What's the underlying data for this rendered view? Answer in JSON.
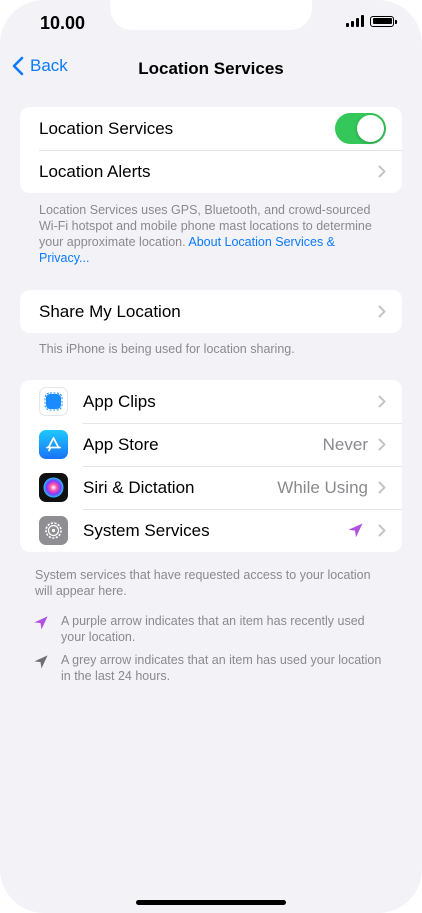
{
  "status_bar": {
    "time": "10.00"
  },
  "nav": {
    "back_label": "Back",
    "title": "Location Services"
  },
  "group1": {
    "location_services_label": "Location Services",
    "location_services_on": true,
    "location_alerts_label": "Location Alerts"
  },
  "footnote1": {
    "text": "Location Services uses GPS, Bluetooth, and crowd-sourced Wi-Fi hotspot and mobile phone mast locations to determine your approximate location. ",
    "link": "About Location Services & Privacy..."
  },
  "group2": {
    "share_label": "Share My Location"
  },
  "footnote2": {
    "text": "This iPhone is being used for location sharing."
  },
  "apps": [
    {
      "label": "App Clips",
      "value": "",
      "icon": "app-clips-icon"
    },
    {
      "label": "App Store",
      "value": "Never",
      "icon": "app-store-icon"
    },
    {
      "label": "Siri & Dictation",
      "value": "While Using",
      "icon": "siri-icon"
    },
    {
      "label": "System Services",
      "value": "",
      "icon": "settings-gear-icon",
      "indicator": "purple-arrow-icon"
    }
  ],
  "footnote3": {
    "text": "System services that have requested access to your location will appear here."
  },
  "legend": {
    "purple": "A purple arrow indicates that an item has recently used your location.",
    "grey": "A grey arrow indicates that an item has used your location in the last 24 hours."
  },
  "colors": {
    "accent": "#0a7aff",
    "toggle_on": "#34c759",
    "purple_arrow": "#af52de",
    "grey_arrow": "#8a8a8e"
  }
}
